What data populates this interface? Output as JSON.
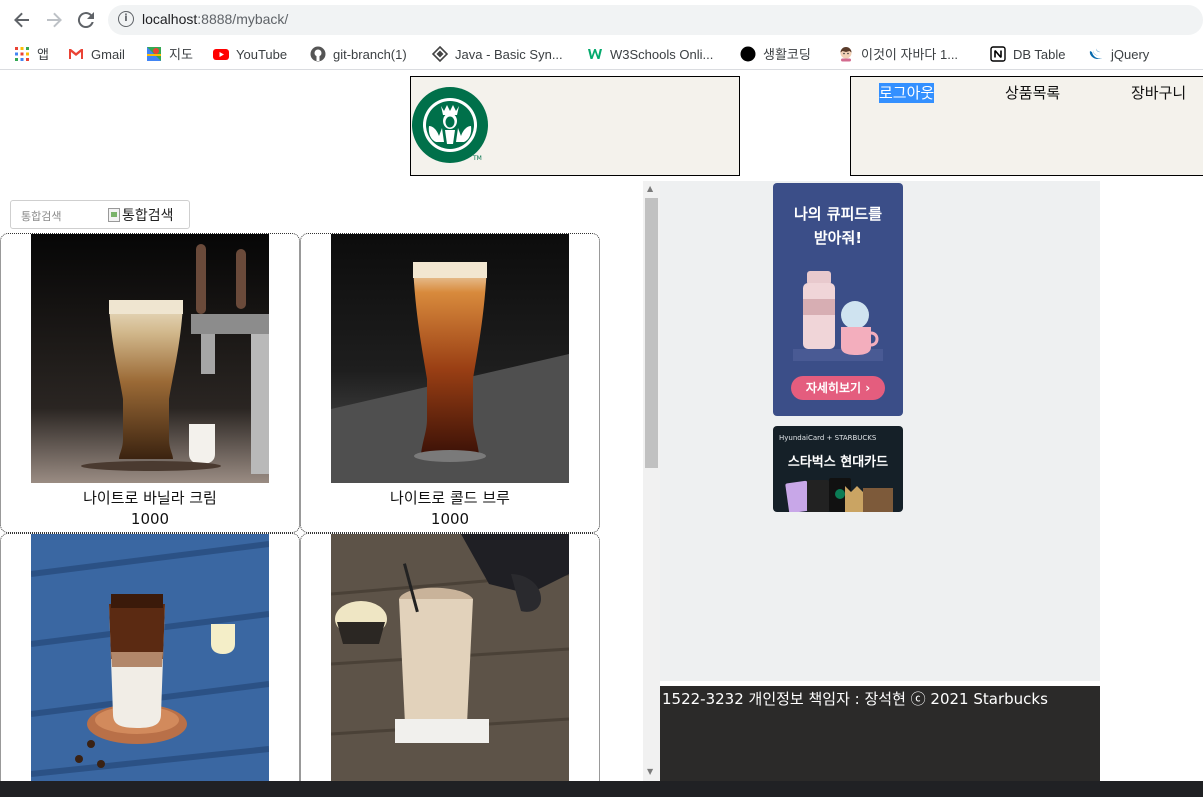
{
  "browser": {
    "url_host": "localhost",
    "url_rest": ":8888/myback/",
    "bookmarks": [
      {
        "label": "앱",
        "icon": "apps-grid-icon"
      },
      {
        "label": "Gmail",
        "icon": "gmail-icon"
      },
      {
        "label": "지도",
        "icon": "maps-icon"
      },
      {
        "label": "YouTube",
        "icon": "youtube-icon"
      },
      {
        "label": "git-branch(1)",
        "icon": "github-icon"
      },
      {
        "label": "Java - Basic Syn...",
        "icon": "java-diamond-icon"
      },
      {
        "label": "W3Schools Onli...",
        "icon": "w3schools-icon"
      },
      {
        "label": "생활코딩",
        "icon": "black-circle-icon"
      },
      {
        "label": "이것이 자바다 1...",
        "icon": "avatar-icon"
      },
      {
        "label": "DB Table",
        "icon": "notion-icon"
      },
      {
        "label": "jQuery",
        "icon": "jquery-icon"
      }
    ]
  },
  "header": {
    "menu": [
      "로그아웃",
      "상품목록",
      "장바구니"
    ],
    "logo": "starbucks-siren-logo"
  },
  "search": {
    "placeholder": "통합검색",
    "button_alt": "통합검색"
  },
  "products": [
    {
      "name": "나이트로 바닐라 크림",
      "price": "1000"
    },
    {
      "name": "나이트로 콜드 브루",
      "price": "1000"
    },
    {
      "name": "",
      "price": ""
    },
    {
      "name": "",
      "price": ""
    }
  ],
  "ads": {
    "ad1_line1": "나의 큐피드를",
    "ad1_line2": "받아줘!",
    "ad1_cta": "자세히보기 ›",
    "ad2_top": "HyundaiCard + STARBUCKS",
    "ad2_title": "스타벅스 현대카드"
  },
  "footer": {
    "text": "1522-3232 개인정보 책임자 : 장석현 ⓒ 2021 Starbucks"
  },
  "colors": {
    "accent_selection": "#3390ff",
    "header_bg": "#f4f2ec",
    "footer_bg": "#2b2a29",
    "starbucks_green": "#00704a"
  }
}
